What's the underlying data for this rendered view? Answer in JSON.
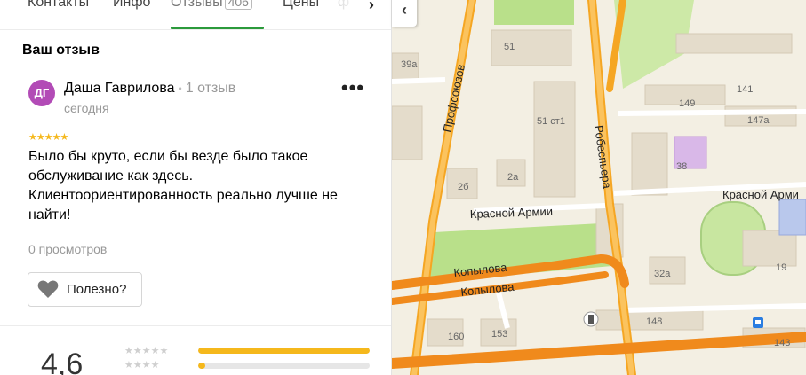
{
  "tabs": {
    "contacts": "Контакты",
    "info": "Инфо",
    "reviews": "Отзывы",
    "reviews_count": "406",
    "prices": "Цены",
    "next_glyph": "›"
  },
  "review": {
    "section_title": "Ваш отзыв",
    "avatar_initials": "ДГ",
    "author": "Даша Гаврилова",
    "author_reviews": "1 отзыв",
    "date": "сегодня",
    "more_glyph": "•••",
    "stars": "★★★★★",
    "rating": 5,
    "text": "Было бы круто, если бы везде было такое обслуживание как здесь. Клиентоориентированность реально лучше не найти!",
    "views": "0 просмотров",
    "helpful_label": "Полезно?"
  },
  "summary": {
    "average": "4,6",
    "rows": [
      {
        "stars": "★★★★★",
        "fill": 1.0
      },
      {
        "stars": "★★★★",
        "fill": 0.04
      }
    ]
  },
  "map": {
    "labels": {
      "profsoyuzov": "Профсоюзов",
      "robespiera": "Робеспьера",
      "krasnoy_armii": "Красной Армии",
      "krasnoy_armii_2": "Красной Арми",
      "kopylova_1": "Копылова",
      "kopylova_2": "Копылова"
    },
    "house_numbers": [
      "51",
      "39а",
      "51 ст1",
      "2б",
      "2а",
      "141",
      "149",
      "147а",
      "38",
      "19",
      "32а",
      "148",
      "160",
      "153",
      "143"
    ],
    "collapse_glyph": "‹",
    "colors": {
      "road": "#f5a623",
      "major_road": "#f08a1c",
      "park": "#b9e08a",
      "building": "#e4dccb",
      "school": "#d9b8e8",
      "stadium": "#c8e6a0"
    }
  }
}
